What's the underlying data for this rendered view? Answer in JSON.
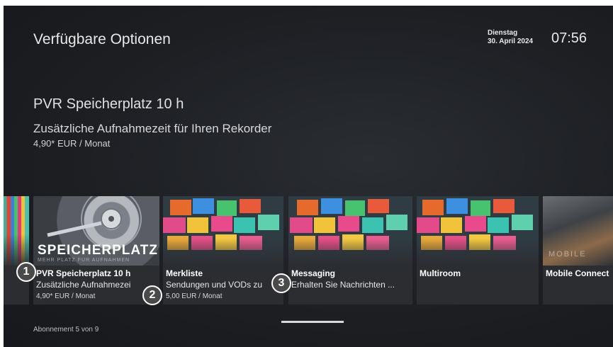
{
  "header": {
    "title": "Verfügbare Optionen",
    "day": "Dienstag",
    "date": "30. April 2024",
    "time": "07:56"
  },
  "detail": {
    "title": "PVR Speicherplatz 10 h",
    "subtitle": "Zusätzliche Aufnahmezeit für Ihren Rekorder",
    "price": "4,90* EUR / Monat"
  },
  "cards": [
    {
      "name": "PVR Speicherplatz 10 h",
      "desc": "Zusätzliche Aufnahmezei",
      "price": "4,90* EUR / Monat",
      "image_text": "SPEICHERPLATZ",
      "image_subtext": "MEHR PLATZ FÜR AUFNAHMEN"
    },
    {
      "name": "Merkliste",
      "desc": "Sendungen und VODs zu",
      "price": "5,00 EUR / Monat"
    },
    {
      "name": "Messaging",
      "desc": "Erhalten Sie Nachrichten ..."
    },
    {
      "name": "Multiroom"
    },
    {
      "name": "Mobile Connect",
      "image_text": "MOBILE"
    }
  ],
  "badges": [
    "1",
    "2",
    "3"
  ],
  "footer": {
    "subscription_count": "Abonnement 5 von 9",
    "carousel_position": 0.56
  },
  "colors": {
    "focus": "#3aa5e6",
    "background": "#1d1f23"
  }
}
